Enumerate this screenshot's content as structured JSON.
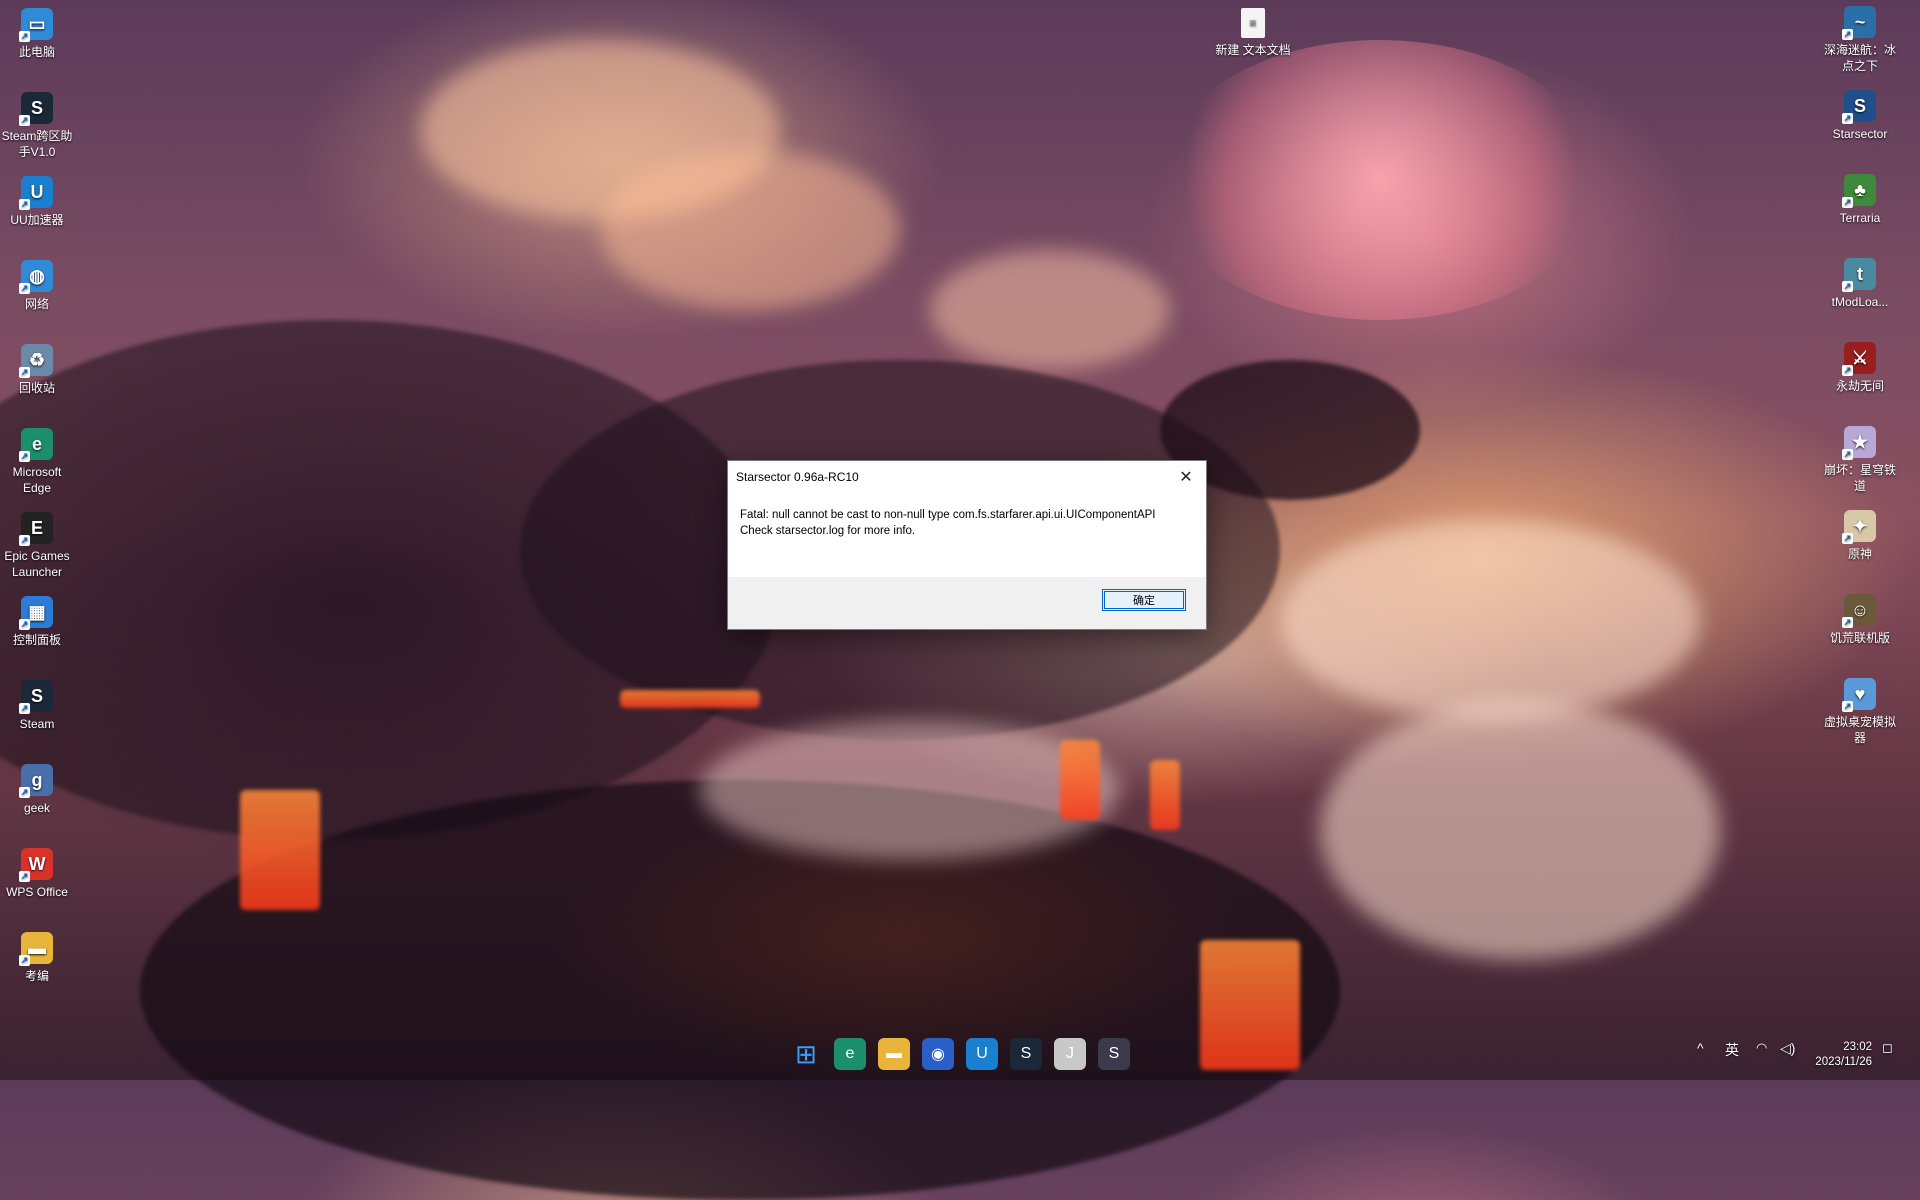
{
  "desktop": {
    "left_icons": [
      {
        "label": "此电脑",
        "icon": "computer-icon",
        "color": "#2f8ad8"
      },
      {
        "label": "Steam跨区助手V1.0",
        "icon": "steam-tool-icon",
        "color": "#1b2838"
      },
      {
        "label": "UU加速器",
        "icon": "uu-accelerator-icon",
        "color": "#1a7fcf"
      },
      {
        "label": "网络",
        "icon": "network-icon",
        "color": "#2f8ad8"
      },
      {
        "label": "回收站",
        "icon": "recycle-bin-icon",
        "color": "#6a8aa8"
      },
      {
        "label": "Microsoft Edge",
        "icon": "edge-icon",
        "color": "#1b8f6a"
      },
      {
        "label": "Epic Games Launcher",
        "icon": "epic-games-icon",
        "color": "#222222"
      },
      {
        "label": "控制面板",
        "icon": "control-panel-icon",
        "color": "#2c7bd6"
      },
      {
        "label": "Steam",
        "icon": "steam-icon",
        "color": "#1b2838"
      },
      {
        "label": "geek",
        "icon": "geek-icon",
        "color": "#4a6ea8"
      },
      {
        "label": "WPS Office",
        "icon": "wps-office-icon",
        "color": "#d8332a"
      },
      {
        "label": "考编",
        "icon": "folder-icon",
        "color": "#e8b53a"
      }
    ],
    "right_icons": [
      {
        "label": "深海迷航：冰点之下",
        "icon": "subnautica-icon",
        "color": "#2a6fa8"
      },
      {
        "label": "Starsector",
        "icon": "starsector-icon",
        "color": "#1f4f8a"
      },
      {
        "label": "Terraria",
        "icon": "terraria-icon",
        "color": "#3f8a3a"
      },
      {
        "label": "tModLoa...",
        "icon": "tmodloader-icon",
        "color": "#4a8aa0"
      },
      {
        "label": "永劫无间",
        "icon": "naraka-icon",
        "color": "#9a1e1e"
      },
      {
        "label": "崩坏：星穹铁道",
        "icon": "star-rail-icon",
        "color": "#b8a8d8"
      },
      {
        "label": "原神",
        "icon": "genshin-icon",
        "color": "#d8c8a8"
      },
      {
        "label": "饥荒联机版",
        "icon": "dont-starve-icon",
        "color": "#6a5a3a"
      },
      {
        "label": "虚拟桌宠模拟器",
        "icon": "virtual-pet-icon",
        "color": "#5a9ad8"
      }
    ],
    "top_file": {
      "label": "新建 文本文档",
      "icon": "text-file-icon"
    }
  },
  "dialog": {
    "title": "Starsector 0.96a-RC10",
    "message_line1": "Fatal: null cannot be cast to non-null type com.fs.starfarer.api.ui.UIComponentAPI",
    "message_line2": "Check starsector.log for more info.",
    "ok_label": "确定",
    "close_glyph": "✕"
  },
  "taskbar": {
    "apps": [
      {
        "name": "start-button",
        "icon": "windows-start-icon",
        "color": "#3aa0ff"
      },
      {
        "name": "edge",
        "icon": "edge-icon",
        "color": "#1b8f6a"
      },
      {
        "name": "file-explorer",
        "icon": "folder-icon",
        "color": "#e8b53a"
      },
      {
        "name": "camera-app",
        "icon": "camera-icon",
        "color": "#2a5fc8"
      },
      {
        "name": "uu-accelerator",
        "icon": "uu-accelerator-icon",
        "color": "#1a7fcf"
      },
      {
        "name": "steam",
        "icon": "steam-icon",
        "color": "#1b2838"
      },
      {
        "name": "java-app",
        "icon": "java-icon",
        "color": "#c8c8c8"
      },
      {
        "name": "starsector",
        "icon": "starsector-icon",
        "color": "#3a3a4a"
      }
    ],
    "tray": {
      "chevron": "^",
      "ime": "英",
      "time": "23:02",
      "date": "2023/11/26"
    }
  }
}
